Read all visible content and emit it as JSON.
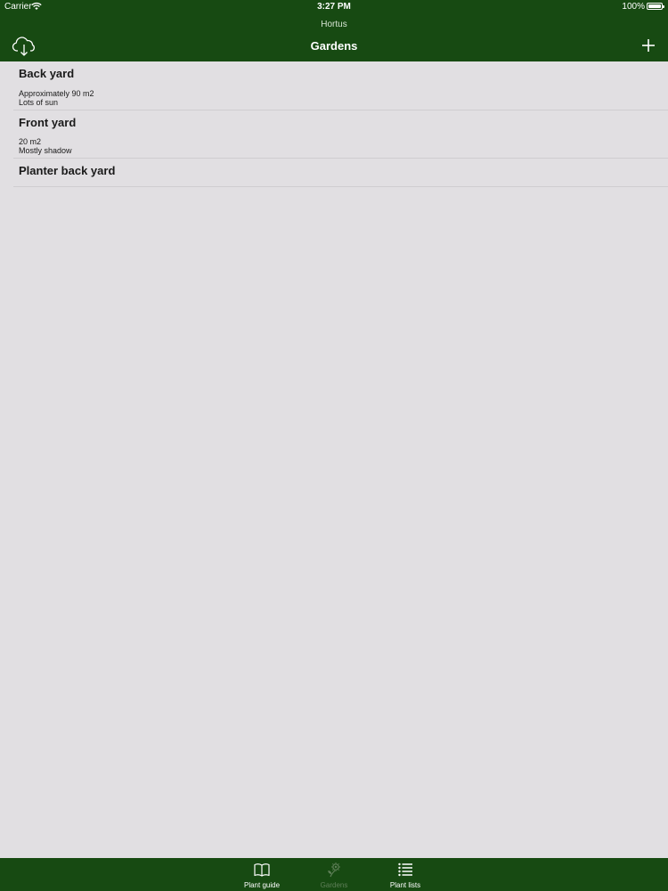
{
  "status_bar": {
    "carrier": "Carrier",
    "time": "3:27 PM",
    "battery": "100%"
  },
  "header": {
    "app_name": "Hortus",
    "title": "Gardens",
    "left_icon": "cloud-download-icon",
    "right_icon": "plus-icon"
  },
  "gardens": [
    {
      "name": "Back yard",
      "lines": [
        "Approximately 90 m2",
        "Lots of sun"
      ]
    },
    {
      "name": "Front yard",
      "lines": [
        "20 m2",
        "Mostly shadow"
      ]
    },
    {
      "name": "Planter back yard",
      "lines": []
    }
  ],
  "tabs": [
    {
      "label": "Plant guide",
      "icon": "book-icon",
      "selected": false
    },
    {
      "label": "Gardens",
      "icon": "plant-icon",
      "selected": true
    },
    {
      "label": "Plant lists",
      "icon": "list-icon",
      "selected": false
    }
  ],
  "colors": {
    "bar": "#174a12",
    "background": "#e1dfe2",
    "selected_tab": "#5f7f58"
  }
}
